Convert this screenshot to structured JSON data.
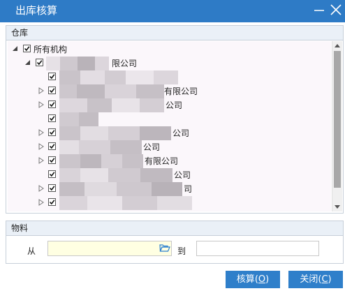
{
  "window": {
    "title": "出库核算"
  },
  "warehouse": {
    "heading": "仓库",
    "tree": {
      "root_label": "所有机构",
      "company_visible_text": "限公司",
      "rows": [
        {
          "visible_text": "有限公司"
        },
        {
          "visible_text": "公司"
        },
        {
          "visible_text": ""
        },
        {
          "visible_text": "公司"
        },
        {
          "visible_text": "公司"
        },
        {
          "visible_text": "有限公司"
        },
        {
          "visible_text": "公司"
        },
        {
          "visible_text": "司"
        },
        {
          "visible_text": ""
        }
      ]
    }
  },
  "material": {
    "heading": "物料",
    "from_label": "从",
    "to_label": "到",
    "from_value": "",
    "to_value": ""
  },
  "buttons": {
    "calc_label": "核算",
    "calc_hotkey": "O",
    "close_label": "关闭",
    "close_hotkey": "C"
  }
}
